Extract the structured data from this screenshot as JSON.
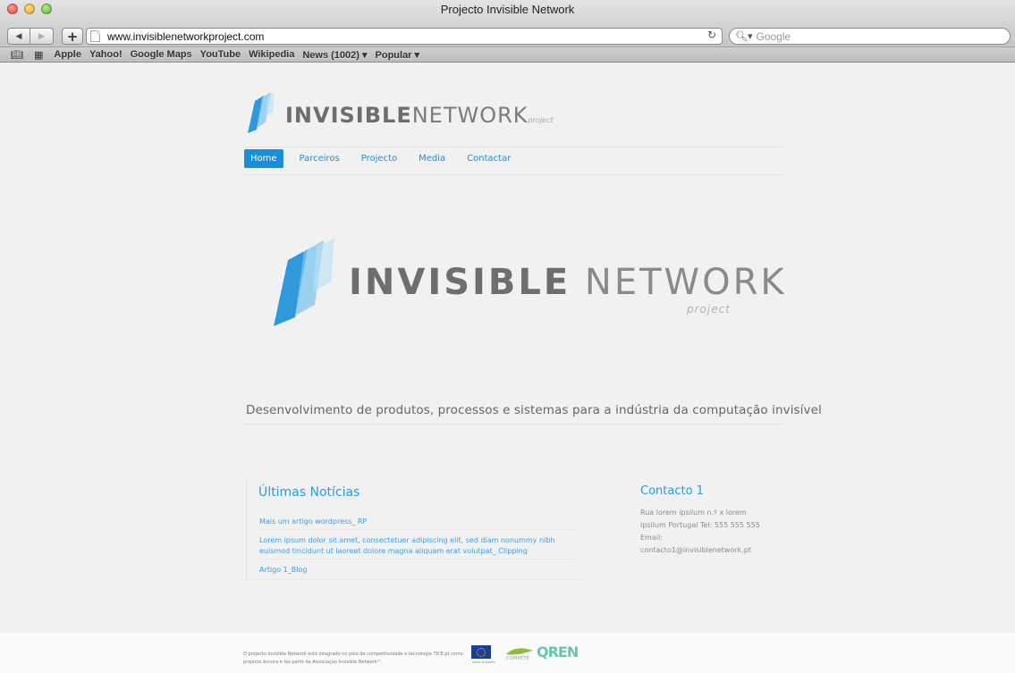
{
  "window": {
    "title": "Projecto Invisible Network",
    "url": "www.invisiblenetworkproject.com",
    "search_placeholder": "Google"
  },
  "bookmarks": [
    "Apple",
    "Yahoo!",
    "Google Maps",
    "YouTube",
    "Wikipedia",
    "News (1002) ▾",
    "Popular ▾"
  ],
  "logo": {
    "word_bold": "INVISIBLE",
    "word_light": "NETWORK",
    "sub": "project"
  },
  "nav": [
    {
      "label": "Home",
      "active": true
    },
    {
      "label": "Parceiros",
      "active": false
    },
    {
      "label": "Projecto",
      "active": false
    },
    {
      "label": "Media",
      "active": false
    },
    {
      "label": "Contactar",
      "active": false
    }
  ],
  "tagline": "Desenvolvimento de produtos, processos e sistemas para a indústria da computação invisível",
  "news": {
    "title": "Últimas Notícias",
    "items": [
      "Mais um artigo wordpress_ RP",
      "Lorem ipsum dolor sit amet, consectetuer adipiscing elit, sed diam nonummy nibh euismod tincidunt ut laoreet dolore magna aliquam erat volutpat_ Clipping",
      "Artigo 1_Blog"
    ]
  },
  "contact": {
    "title": "Contacto 1",
    "text": "Rua lorem ipsilum n.º x lorem ipsilum Portugal Tel: 555 555 555 Email: contacto1@invisiblenetwork.pt"
  },
  "footer": {
    "text": "O projecto Invisible Network está integrado no pólo de competitividade e tecnologia TICE.pt como projecto âncora e faz parte da Associação Invisible Network™.",
    "eu_caption": "UNIÃO EUROPEIA",
    "compete_label": "COMPETE",
    "cen_letters": "QREN"
  },
  "colors": {
    "accent": "#1a8fd8",
    "logo_blue_dark": "#1a8fd8",
    "logo_blue_light": "#8fd0f0"
  }
}
